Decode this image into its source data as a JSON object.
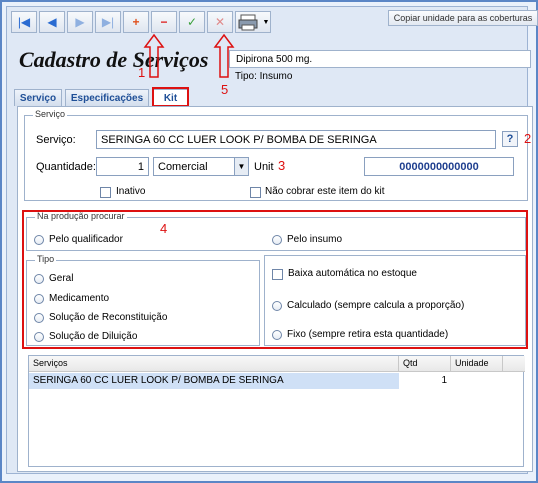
{
  "toolbar": {
    "first": "|◀",
    "prev": "◀",
    "next": "▶",
    "last": "▶|",
    "add": "+",
    "remove": "−",
    "confirm": "✓",
    "cancel": "✕",
    "copy_label": "Copiar unidade para as coberturas"
  },
  "header": {
    "title": "Cadastro de Serviços",
    "record": "Dipirona 500 mg.",
    "tipo": "Tipo: Insumo"
  },
  "annotations": {
    "a1": "1",
    "a2": "2",
    "a3": "3",
    "a4": "4",
    "a5": "5"
  },
  "tabs": [
    "Serviço",
    "Especificações",
    "Kit"
  ],
  "servico_group": {
    "label": "Serviço",
    "servico_label": "Serviço:",
    "servico_value": "SERINGA 60 CC LUER LOOK P/ BOMBA DE SERINGA",
    "help": "?",
    "quantidade_label": "Quantidade:",
    "quantidade_value": "1",
    "unidade_value": "Comercial",
    "unit_label": "Unit",
    "codigo_value": "0000000000000",
    "inativo_label": "Inativo",
    "nao_cobrar_label": "Não cobrar este item do kit"
  },
  "producao_group": {
    "label": "Na produção procurar",
    "option1": "Pelo qualificador",
    "option2": "Pelo insumo"
  },
  "tipo_group": {
    "label": "Tipo",
    "options": [
      "Geral",
      "Medicamento",
      "Solução de Reconstituição",
      "Solução de Diluição"
    ]
  },
  "baixa": {
    "checkbox": "Baixa automática no estoque",
    "calc": "Calculado (sempre calcula a proporção)",
    "fixo": "Fixo (sempre retira esta quantidade)"
  },
  "table": {
    "headers": [
      "Serviços",
      "Qtd",
      "Unidade"
    ],
    "rows": [
      {
        "servico": "SERINGA 60 CC LUER LOOK P/ BOMBA DE SERINGA",
        "qtd": "1",
        "unidade": ""
      }
    ]
  }
}
